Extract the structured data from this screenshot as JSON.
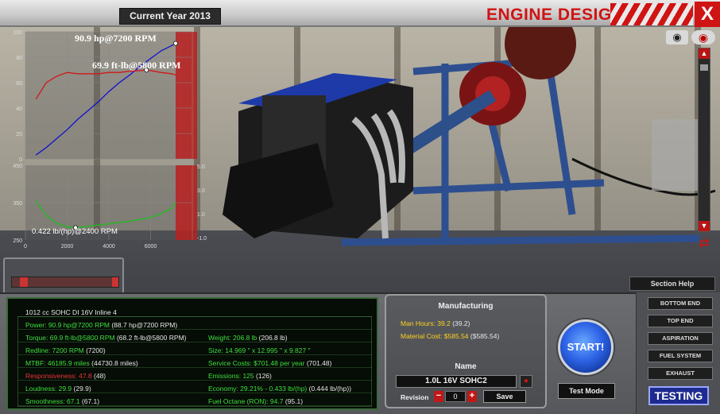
{
  "header": {
    "year_label": "Current Year 2013",
    "title": "ENGINE DESIGN",
    "close_label": "X"
  },
  "chart_data": [
    {
      "type": "line",
      "title": "",
      "xlabel": "",
      "ylabel": "",
      "xlim": [
        0,
        8000
      ],
      "ylim": [
        0,
        100
      ],
      "yticks": [
        "0",
        "20",
        "40",
        "60",
        "80",
        "100"
      ],
      "grid": true,
      "annotations": [
        "90.9 hp@7200 RPM",
        "69.9 ft-lb@5800 RPM"
      ],
      "series": [
        {
          "color": "#1010d0",
          "x": [
            500,
            1000,
            1500,
            2000,
            2500,
            3000,
            3500,
            4000,
            4500,
            5000,
            5500,
            6000,
            6500,
            7000,
            7200
          ],
          "values": [
            3,
            9,
            16,
            23,
            31,
            38,
            45,
            53,
            60,
            66,
            73,
            79,
            85,
            89,
            90.9
          ]
        },
        {
          "color": "#d01818",
          "x": [
            500,
            1000,
            1500,
            2000,
            2500,
            3000,
            3500,
            4000,
            4500,
            5000,
            5500,
            5800,
            6000,
            6500,
            7000,
            7200
          ],
          "values": [
            47,
            60,
            65,
            68,
            67,
            67,
            67,
            68,
            68,
            69,
            69.5,
            69.9,
            69.5,
            68,
            67,
            66
          ]
        }
      ]
    },
    {
      "type": "line",
      "title": "",
      "xlabel": "",
      "ylabel": "",
      "xlim": [
        0,
        8000
      ],
      "ylim": [
        250,
        450
      ],
      "xticks": [
        "0",
        "2000",
        "4000",
        "6000"
      ],
      "yticks_left": [
        "250",
        "350",
        "450"
      ],
      "yticks_right": [
        "5.0",
        "3.0",
        "1.0",
        "-1.0"
      ],
      "annotations": [
        "0.422 lb/(hp)@2400 RPM"
      ],
      "series": [
        {
          "color": "#18c018",
          "x": [
            500,
            1000,
            1500,
            2000,
            2400,
            3000,
            3500,
            4000,
            4500,
            5000,
            5500,
            6000,
            6500,
            7000,
            7200
          ],
          "values": [
            355,
            315,
            295,
            285,
            283,
            286,
            290,
            293,
            297,
            300,
            305,
            310,
            320,
            335,
            350
          ]
        }
      ]
    }
  ],
  "side": {
    "section_help": "Section Help"
  },
  "stats": {
    "title": "1012 cc SOHC DI 16V Inline 4",
    "power_k": "Power: 90.9 hp@7200 RPM",
    "power_v": "(88.7 hp@7200 RPM)",
    "torque_k": "Torque: 69.9 ft-lb@5800 RPM",
    "torque_v": "(68.2 ft-lb@5800 RPM)",
    "redline_k": "Redline: 7200 RPM",
    "redline_v": "(7200)",
    "mtbf_k": "MTBF: 46185.9 miles",
    "mtbf_v": "(44730.8 miles)",
    "resp_k": "Responsiveness: 47.8",
    "resp_v": "(48)",
    "loud_k": "Loudness: 29.9",
    "loud_v": "(29.9)",
    "smooth_k": "Smoothness: 67.1",
    "smooth_v": "(67.1)",
    "weight_k": "Weight: 206.8 lb",
    "weight_v": "(206.8 lb)",
    "size_k": "Size: 14.969 \" x 12.995 \" x 9.827 \"",
    "size_v": "",
    "service_k": "Service Costs: $701.48 per year",
    "service_v": "(701.48)",
    "emis_k": "Emissions: 125",
    "emis_v": "(126)",
    "econ_k": "Economy: 29.21% - 0.433 lb/(hp)",
    "econ_v": "(0.444 lb/(hp))",
    "octane_k": "Fuel Octane (RON): 94.7",
    "octane_v": "(95.1)"
  },
  "manufacturing": {
    "title": "Manufacturing",
    "hours_k": "Man Hours: 39.2",
    "hours_v": "(39.2)",
    "cost_k": "Material Cost: $585.54",
    "cost_v": "($585.54)",
    "name_title": "Name",
    "name_value": "1.0L 16V SOHC2",
    "revision_label": "Revision",
    "revision_value": "0",
    "save_label": "Save"
  },
  "actions": {
    "start_label": "START!",
    "test_mode_label": "Test Mode"
  },
  "nav": {
    "items": [
      "BOTTOM END",
      "TOP END",
      "ASPIRATION",
      "FUEL SYSTEM",
      "EXHAUST"
    ],
    "active": "TESTING"
  }
}
